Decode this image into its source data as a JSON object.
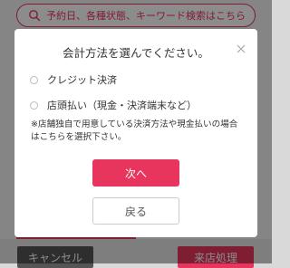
{
  "background": {
    "search_placeholder": "予約日、各種状態、キーワード検索はこちら",
    "cancel_label": "キャンセル",
    "visit_label": "来店処理"
  },
  "modal": {
    "title": "会計方法を選んでください。",
    "close_icon": "close-icon",
    "options": [
      {
        "label": "クレジット決済",
        "selected": false
      },
      {
        "label": "店頭払い（現金・決済端末など）",
        "selected": false
      }
    ],
    "note": "※店舗独自で用意している決済方法や現金払いの場合はこちらを選択下さい。",
    "next_label": "次へ",
    "back_label": "戻る"
  },
  "colors": {
    "accent": "#e8355e",
    "overlay": "rgba(0,0,0,0.45)"
  }
}
